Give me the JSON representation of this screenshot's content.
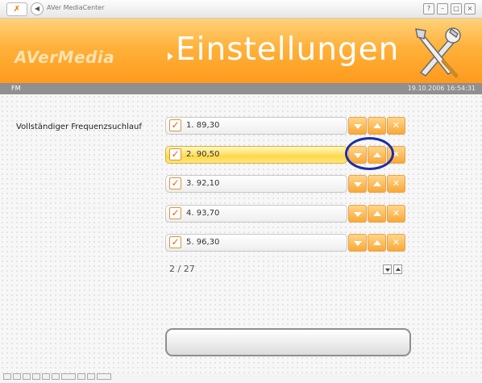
{
  "window": {
    "title": "AVer MediaCenter",
    "logo_glyph": "✗",
    "back_glyph": "◀",
    "controls": {
      "help": "?",
      "minimize": "–",
      "restore": "□",
      "close": "×"
    }
  },
  "banner": {
    "brand": "AVerMedia",
    "title": "Einstellungen",
    "icon": "tools-icon"
  },
  "status": {
    "mode": "FM",
    "datetime": "19.10.2006 16:54:31"
  },
  "setting_label": "Vollständiger Frequenzsuchlauf",
  "channels": [
    {
      "label": "1. 89,30",
      "checked": true,
      "selected": false
    },
    {
      "label": "2. 90,50",
      "checked": true,
      "selected": true
    },
    {
      "label": "3. 92,10",
      "checked": true,
      "selected": false
    },
    {
      "label": "4. 93,70",
      "checked": true,
      "selected": false
    },
    {
      "label": "5. 96,30",
      "checked": true,
      "selected": false
    }
  ],
  "checkmark": "✓",
  "delete_glyph": "✕",
  "pagination": {
    "text": "2 / 27"
  },
  "colors": {
    "accent_orange": "#ff9a1d",
    "selected_row": "#ffd84a",
    "highlight_ring": "#1c2ea6",
    "status_strip": "#909090"
  }
}
